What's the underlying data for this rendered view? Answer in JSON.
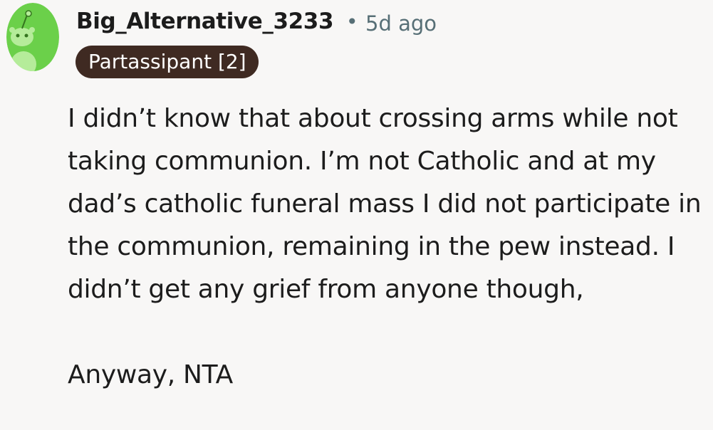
{
  "comment": {
    "avatar_icon": "reddit-snoo-avatar",
    "avatar_color": "#6bd04a",
    "username": "Big_Alternative_3233",
    "separator": "•",
    "timestamp": "5d ago",
    "flair": "Partassipant [2]",
    "flair_color": "#3f2a22",
    "paragraphs": [
      "I didn’t know that about crossing arms while not taking communion. I’m not Catholic and at my dad’s catholic funeral mass I did not participate in the communion, remaining in the pew instead. I didn’t get any grief from anyone though,",
      "Anyway, NTA"
    ]
  }
}
